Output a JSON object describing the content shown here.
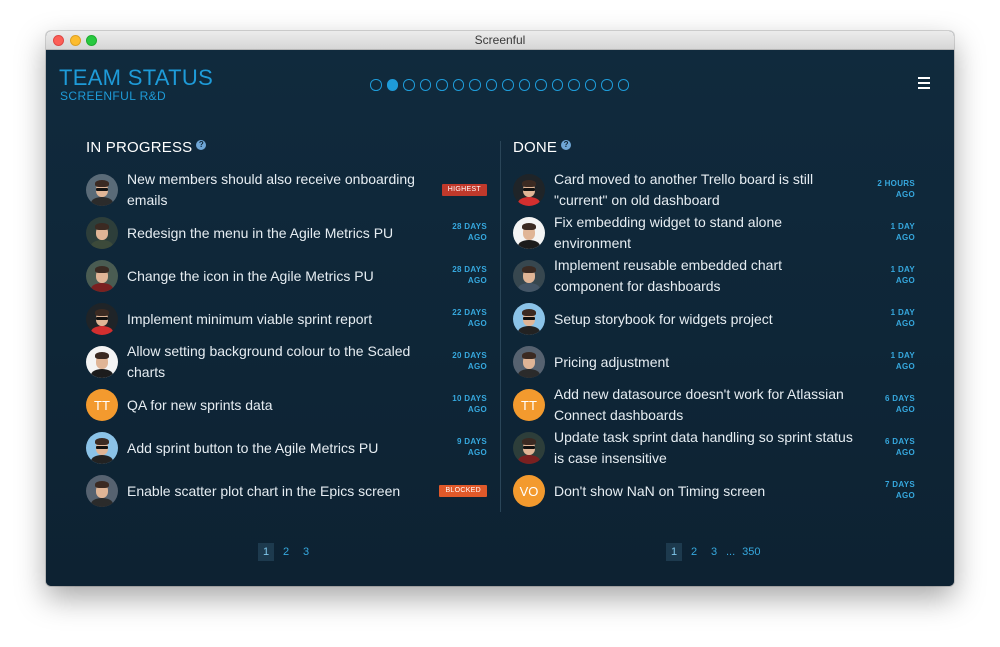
{
  "window": {
    "title": "Screenful"
  },
  "header": {
    "title": "TEAM STATUS",
    "subtitle": "SCREENFUL R&D",
    "dots_count": 16,
    "active_dot": 1
  },
  "in_progress": {
    "heading": "IN PROGRESS",
    "cards": [
      {
        "title": "New members should also receive onboarding emails",
        "badge": "HIGHEST",
        "badge_type": "highest",
        "avatar": "photo"
      },
      {
        "title": "Redesign the menu in the Agile Metrics PU",
        "time": "28 DAYS AGO",
        "avatar": "photo"
      },
      {
        "title": "Change the icon in the Agile Metrics PU",
        "time": "28 DAYS AGO",
        "avatar": "photo"
      },
      {
        "title": "Implement minimum viable sprint report",
        "time": "22 DAYS AGO",
        "avatar": "photo"
      },
      {
        "title": "Allow setting background colour to the Scaled charts",
        "time": "20 DAYS AGO",
        "avatar": "photo"
      },
      {
        "title": "QA for new sprints data",
        "time": "10 DAYS AGO",
        "avatar": "initials",
        "initials": "TT"
      },
      {
        "title": "Add sprint button to the Agile Metrics PU",
        "time": "9 DAYS AGO",
        "avatar": "photo"
      },
      {
        "title": "Enable scatter plot chart in the Epics screen",
        "badge": "BLOCKED",
        "badge_type": "blocked",
        "avatar": "photo"
      }
    ],
    "pages": [
      "1",
      "2",
      "3"
    ],
    "current_page": "1"
  },
  "done": {
    "heading": "DONE",
    "cards": [
      {
        "title": "Card moved to another Trello board is still \"current\" on old dashboard",
        "time": "2 HOURS AGO",
        "avatar": "photo"
      },
      {
        "title": "Fix embedding widget to stand alone environment",
        "time": "1 DAY AGO",
        "avatar": "photo"
      },
      {
        "title": "Implement reusable embedded chart component for dashboards",
        "time": "1 DAY AGO",
        "avatar": "photo"
      },
      {
        "title": "Setup storybook for widgets project",
        "time": "1 DAY AGO",
        "avatar": "photo"
      },
      {
        "title": "Pricing adjustment",
        "time": "1 DAY AGO",
        "avatar": "photo"
      },
      {
        "title": "Add new datasource doesn't work for Atlassian Connect dashboards",
        "time": "6 DAYS AGO",
        "avatar": "initials",
        "initials": "TT"
      },
      {
        "title": "Update task sprint data handling so sprint status is case insensitive",
        "time": "6 DAYS AGO",
        "avatar": "photo"
      },
      {
        "title": "Don't show NaN on Timing screen",
        "time": "7 DAYS AGO",
        "avatar": "initials",
        "initials": "VO"
      }
    ],
    "pages": [
      "1",
      "2",
      "3"
    ],
    "ellipsis": "...",
    "last_page": "350",
    "current_page": "1"
  },
  "colors": {
    "accent": "#1e9bd8",
    "background": "#0e2434",
    "highest_badge": "#c0392b",
    "blocked_badge": "#e0592a",
    "initials_avatar": "#f39a2e"
  }
}
